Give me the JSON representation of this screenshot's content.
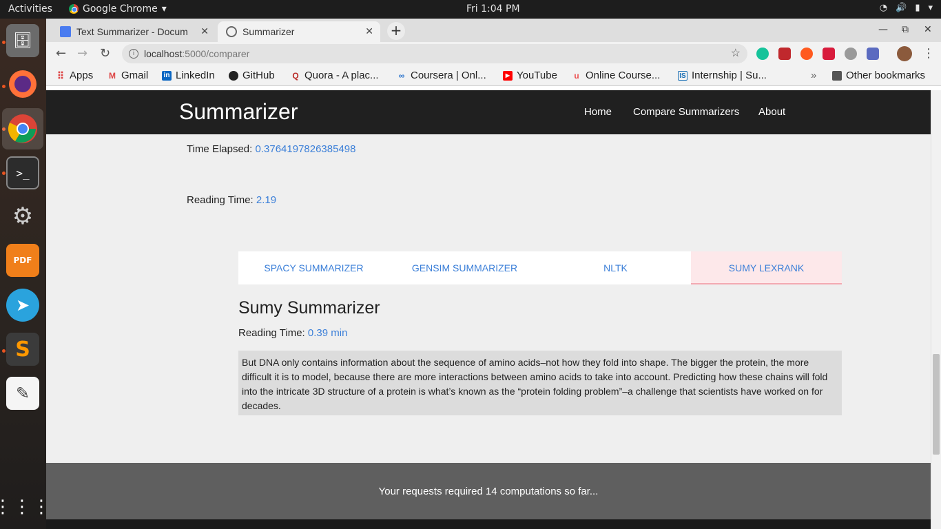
{
  "system": {
    "activities": "Activities",
    "app_name": "Google Chrome",
    "clock": "Fri  1:04 PM"
  },
  "browser": {
    "tabs": [
      {
        "title": "Text Summarizer - Docum"
      },
      {
        "title": "Summarizer"
      }
    ],
    "url_host": "localhost",
    "url_path": ":5000/comparer",
    "bookmarks": [
      "Apps",
      "Gmail",
      "LinkedIn",
      "GitHub",
      "Quora - A plac...",
      "Coursera | Onl...",
      "YouTube",
      "Online Course...",
      "Internship | Su..."
    ],
    "overflow": "»",
    "other_bookmarks": "Other bookmarks"
  },
  "site": {
    "brand": "Summarizer",
    "nav": [
      "Home",
      "Compare Summarizers",
      "About"
    ]
  },
  "stats": {
    "time_elapsed_label": "Time Elapsed: ",
    "time_elapsed_value": "0.3764197826385498",
    "reading_time_label": "Reading Time: ",
    "reading_time_value": "2.19"
  },
  "compare_tabs": [
    "SPACY SUMMARIZER",
    "GENSIM SUMMARIZER",
    "NLTK",
    "SUMY LEXRANK"
  ],
  "summary": {
    "title": "Sumy Summarizer",
    "reading_time_label": "Reading Time: ",
    "reading_time_value": "0.39 min",
    "text": "But DNA only contains information about the sequence of amino acids–not how they fold into shape. The bigger the protein, the more difficult it is to model, because there are more interactions between amino acids to take into account. Predicting how these chains will fold into the intricate 3D structure of a protein is what’s known as the “protein folding problem”–a challenge that scientists have worked on for decades."
  },
  "footer": {
    "text": "Your requests required 14 computations so far..."
  },
  "colors": {
    "navbar": "#202020",
    "link": "#3b7fd8",
    "selected_tab": "#fde8ea",
    "footer": "#5f5f5f"
  }
}
